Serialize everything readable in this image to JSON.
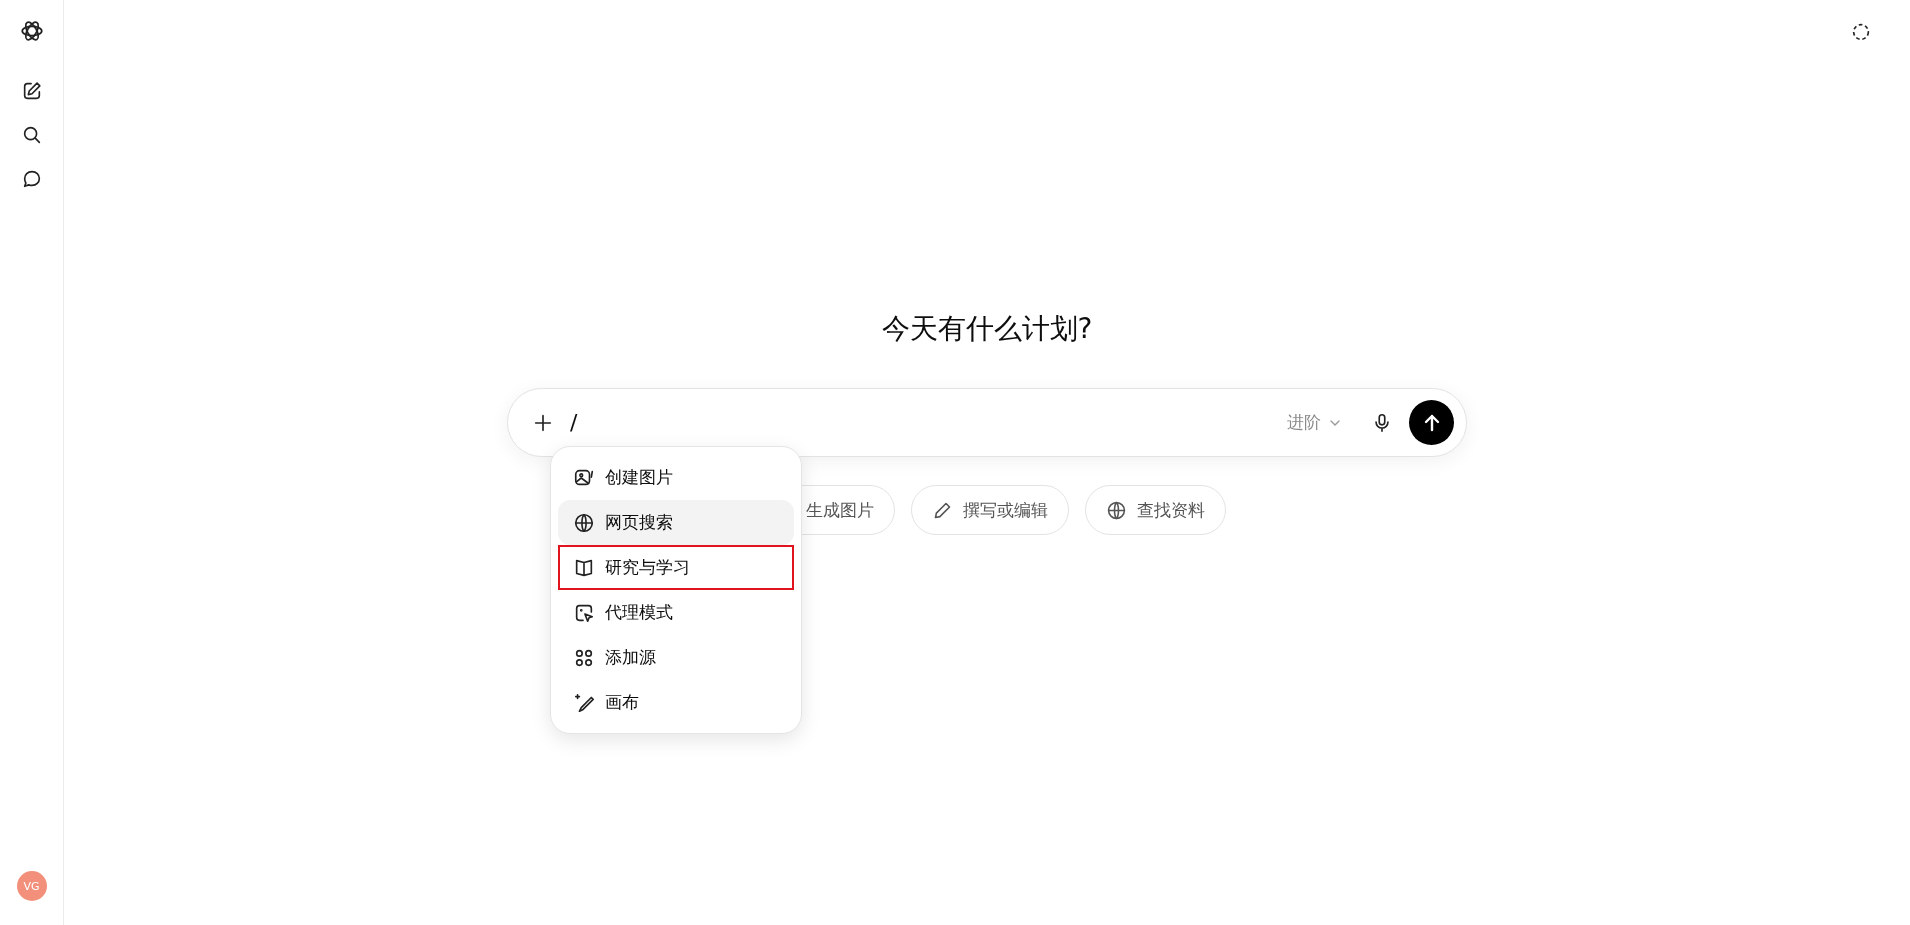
{
  "sidebar": {
    "avatar": "VG"
  },
  "heading": "今天有什么计划?",
  "composer": {
    "value": "/",
    "model": "进阶"
  },
  "menu": [
    {
      "label": "创建图片",
      "kind": "image",
      "selected": false,
      "highlighted": false
    },
    {
      "label": "网页搜索",
      "kind": "globe",
      "selected": true,
      "highlighted": false
    },
    {
      "label": "研究与学习",
      "kind": "book",
      "selected": false,
      "highlighted": true
    },
    {
      "label": "代理模式",
      "kind": "agent",
      "selected": false,
      "highlighted": false
    },
    {
      "label": "添加源",
      "kind": "nodes",
      "selected": false,
      "highlighted": false
    },
    {
      "label": "画布",
      "kind": "sparkle",
      "selected": false,
      "highlighted": false
    }
  ],
  "chips": [
    {
      "label": "生成图片"
    },
    {
      "label": "撰写或编辑",
      "kind": "pencil"
    },
    {
      "label": "查找资料",
      "kind": "globe"
    }
  ]
}
